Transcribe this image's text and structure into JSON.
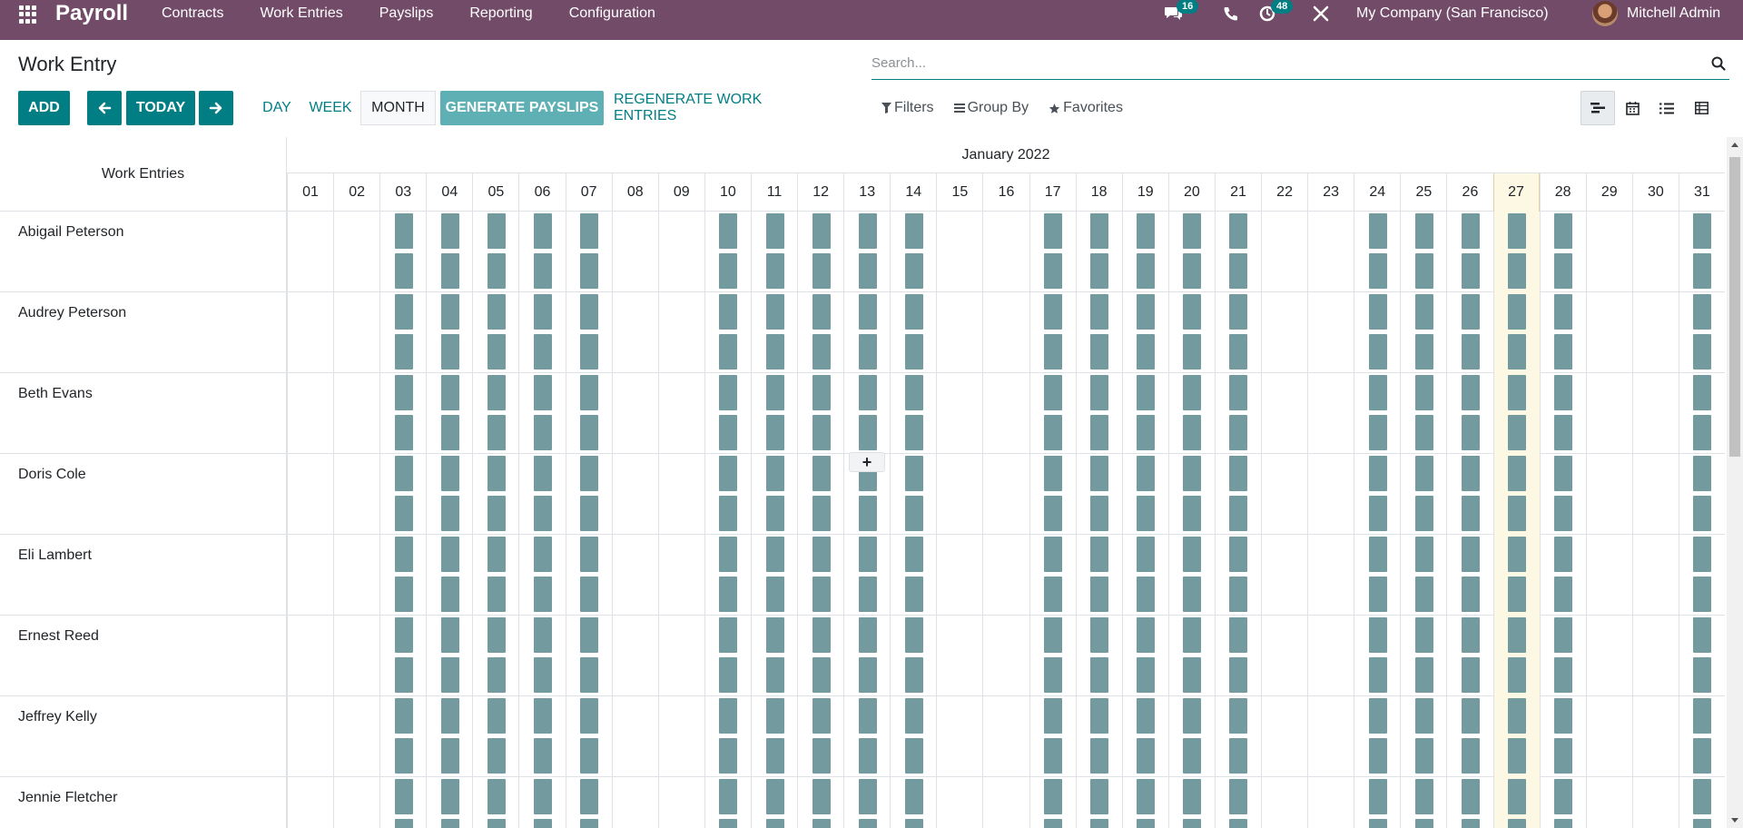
{
  "navbar": {
    "brand": "Payroll",
    "menu": [
      "Contracts",
      "Work Entries",
      "Payslips",
      "Reporting",
      "Configuration"
    ],
    "messages_badge": "16",
    "activities_badge": "48",
    "company": "My Company (San Francisco)",
    "user": "Mitchell Admin"
  },
  "control_panel": {
    "title": "Work Entry",
    "search_placeholder": "Search...",
    "add_label": "ADD",
    "today_label": "TODAY",
    "day_label": "DAY",
    "week_label": "WEEK",
    "month_label": "MONTH",
    "generate_label": "GENERATE PAYSLIPS",
    "regenerate_label": "REGENERATE WORK ENTRIES",
    "filters_label": "Filters",
    "groupby_label": "Group By",
    "favorites_label": "Favorites"
  },
  "gantt": {
    "header_label": "Work Entries",
    "month_label": "January 2022",
    "days": [
      "01",
      "02",
      "03",
      "04",
      "05",
      "06",
      "07",
      "08",
      "09",
      "10",
      "11",
      "12",
      "13",
      "14",
      "15",
      "16",
      "17",
      "18",
      "19",
      "20",
      "21",
      "22",
      "23",
      "24",
      "25",
      "26",
      "27",
      "28",
      "29",
      "30",
      "31"
    ],
    "today": "27",
    "working_days": [
      "03",
      "04",
      "05",
      "06",
      "07",
      "10",
      "11",
      "12",
      "13",
      "14",
      "17",
      "18",
      "19",
      "20",
      "21",
      "24",
      "25",
      "26",
      "27",
      "28",
      "31"
    ],
    "employees": [
      "Abigail Peterson",
      "Audrey Peterson",
      "Beth Evans",
      "Doris Cole",
      "Eli Lambert",
      "Ernest Reed",
      "Jeffrey Kelly",
      "Jennie Fletcher"
    ],
    "add_button": "+"
  },
  "colors": {
    "navbar": "#714b67",
    "primary": "#017e84",
    "generate": "#5fb0b4",
    "work_entry": "#729a9f",
    "today_highlight": "#fcf8e3"
  }
}
